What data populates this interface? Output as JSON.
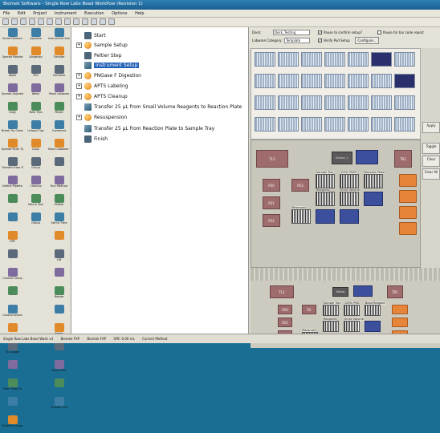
{
  "window": {
    "title": "Biomek Software - Single Row Labs Bead Workflow (Revision 1)"
  },
  "menu": [
    "File",
    "Edit",
    "Project",
    "Instrument",
    "Execution",
    "Options",
    "Help"
  ],
  "palette": {
    "col1": [
      "Serial Dilution",
      "Spread Pipette",
      "Wash",
      "Spread Aspirate",
      "Copy",
      "Break Tip Cleanup",
      "Spread Multi Tips",
      "Transfer from File",
      "Define Pipette",
      "",
      "",
      "SPE",
      "",
      "Control Group",
      "",
      "Control Action",
      "",
      "Tip Loader",
      "",
      "Filter Plate Fil",
      "",
      "Multilane Loop"
    ],
    "col2": [
      "Aspirate",
      "Dispense",
      "Mix",
      "Wash",
      "New Tips",
      "Unload Tips",
      "Loop",
      "Group",
      "Cleanup",
      "Macro Tool",
      "Group"
    ],
    "col3": [
      "Instrument Setup",
      "Transfer",
      "Combine",
      "Move Labware",
      "Pause",
      "Comment",
      "Move Labware with Offset",
      "",
      "Run Method",
      "Shaker",
      "Set to Time",
      "",
      "Lift",
      "",
      "Rotate",
      "",
      "Robot",
      "",
      "Serial Port",
      "",
      "Unplate Out"
    ]
  },
  "steps": [
    {
      "label": "Start",
      "icon": "flag-icon",
      "pm": "",
      "indent": 0
    },
    {
      "label": "Sample Setup",
      "icon": "orb-icon",
      "pm": "+",
      "indent": 0
    },
    {
      "label": "Peltier Step",
      "icon": "device-icon",
      "pm": "",
      "indent": 0
    },
    {
      "label": "Instrument Setup",
      "icon": "setup-icon",
      "pm": "",
      "indent": 0,
      "selected": true
    },
    {
      "label": "PNGase F Digestion",
      "icon": "orb-icon",
      "pm": "+",
      "indent": 0
    },
    {
      "label": "APTS Labeling",
      "icon": "orb-icon",
      "pm": "+",
      "indent": 0
    },
    {
      "label": "APTS Cleanup",
      "icon": "orb-icon",
      "pm": "+",
      "indent": 0
    },
    {
      "label": "Transfer 25 µL from Small Volume Reagents to Reaction Plate",
      "icon": "transfer-icon",
      "pm": "",
      "indent": 0
    },
    {
      "label": "Resuspension",
      "icon": "orb-icon",
      "pm": "+",
      "indent": 0
    },
    {
      "label": "Transfer 25 µL from Reaction Plate to Sample Tray",
      "icon": "transfer-icon",
      "pm": "",
      "indent": 0
    },
    {
      "label": "Finish",
      "icon": "finish-icon",
      "pm": "",
      "indent": 0
    }
  ],
  "config": {
    "deck_label": "Deck:",
    "deck_value": "Deck_Testing",
    "category_label": "Labware Category:",
    "category_value": "Template",
    "chk1": "Pause to confirm setup?",
    "chk2": "Pause for bar code report",
    "chk3": "Verify Pod Setup",
    "config_btn": "Configure..."
  },
  "side_buttons": [
    "Apply",
    "Toggle",
    "Clear",
    "Clear All"
  ],
  "deck1": {
    "slots": [
      "TL1",
      "TR1",
      "P20",
      "P21",
      "P22",
      "P23",
      "TL2",
      "Shaker_1",
      "Reservoir"
    ],
    "plates": [
      "Sample Tray",
      "100% PNGF",
      "Reaction Plate",
      "Reagents",
      "Small Volume",
      "Reservoir"
    ]
  },
  "deck2": {
    "slots": [
      "TL1",
      "TR1",
      "P20",
      "P21",
      "P22",
      "Waste",
      "P2"
    ],
    "plates": [
      "Sample Tray",
      "100% PNG",
      "Bead Reagent",
      "Reagents",
      "Small Volume",
      "Reservoir"
    ]
  },
  "status": [
    "Single Row Labs Bead Wash v4",
    "Biomek FXP",
    "Biomek FXP",
    "SPE: 0.00 mL",
    "Current Method"
  ],
  "colors": {
    "title": "#195f8f",
    "selected": "#1f5fb5",
    "orange": "#e6843a",
    "blue": "#3c4f9c",
    "slot": "#9e6c6c"
  }
}
